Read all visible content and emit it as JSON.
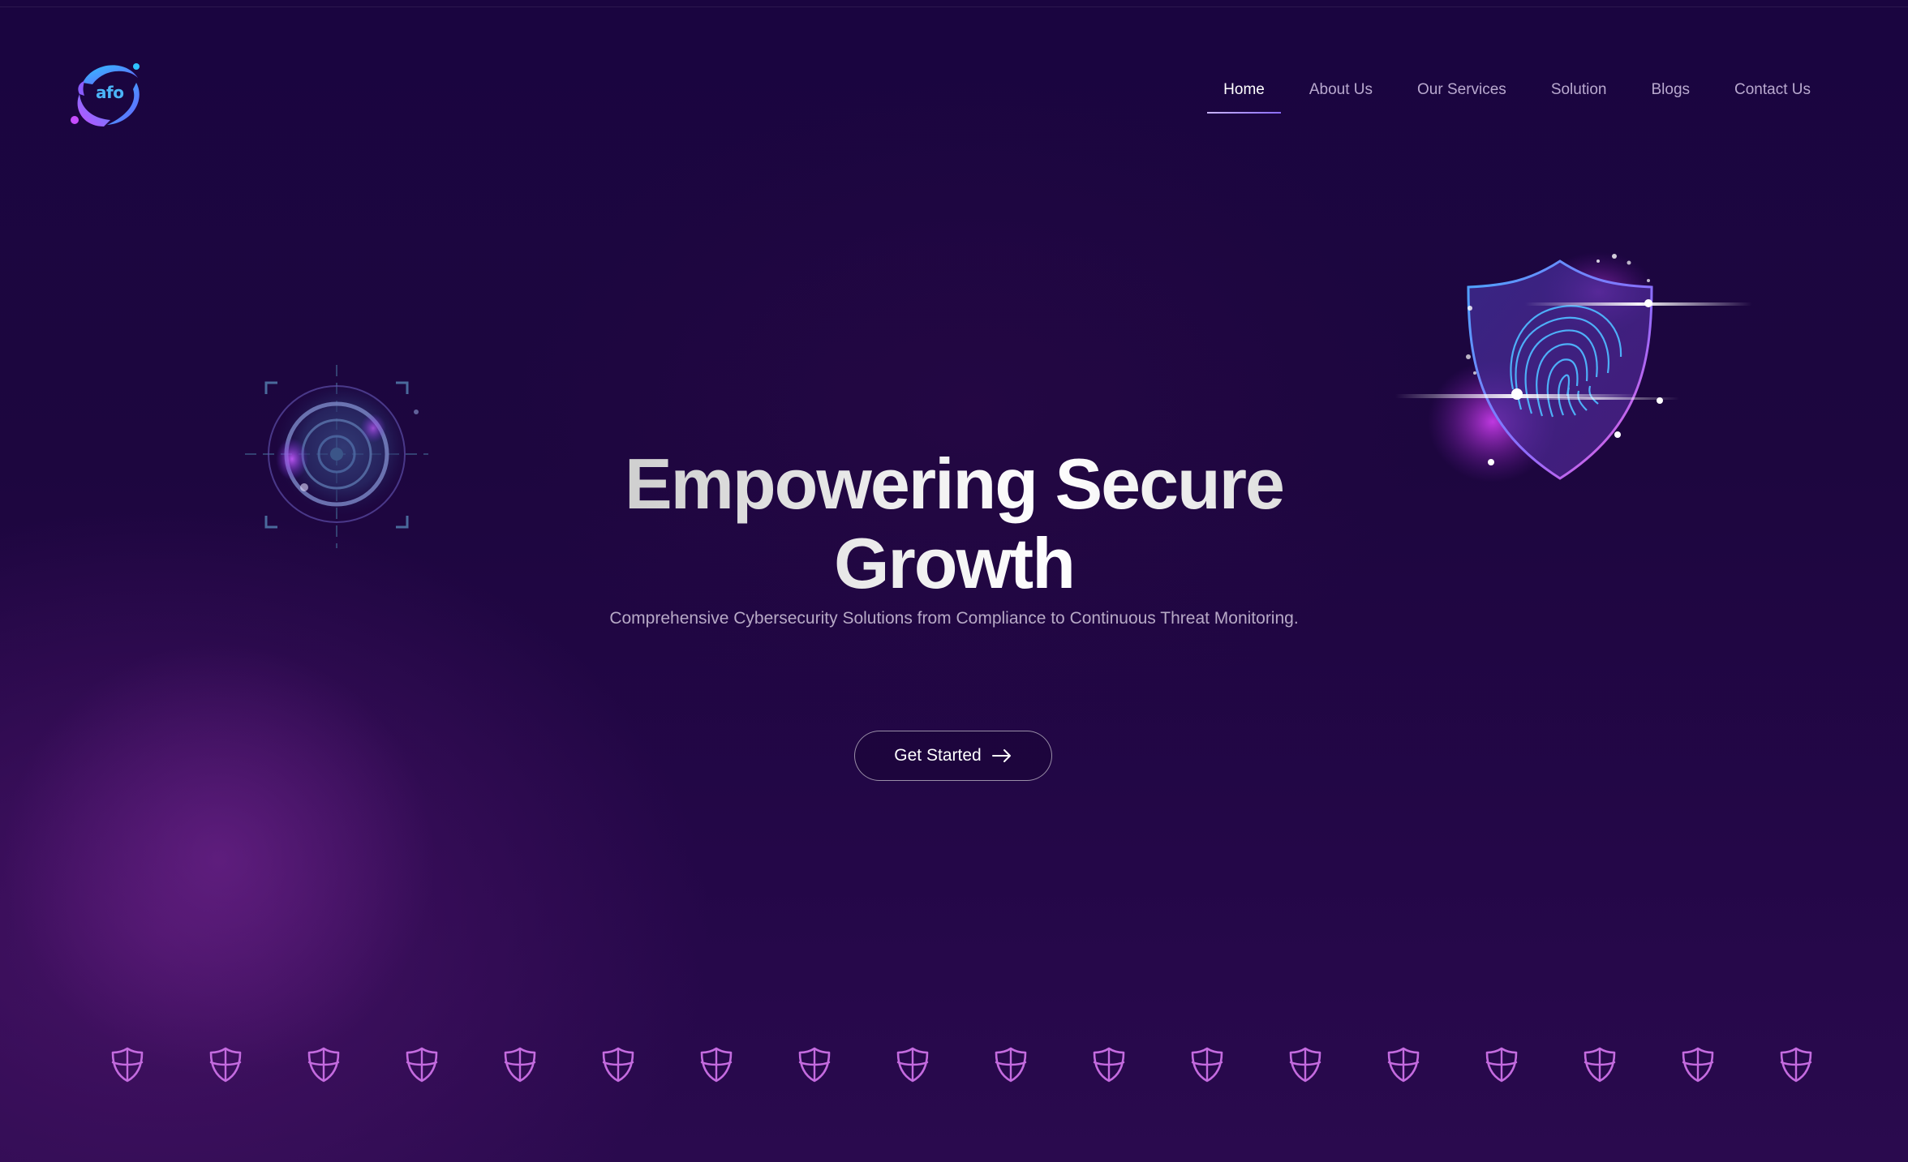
{
  "brand": {
    "logo_text": "afo",
    "colors": {
      "accent_blue": "#3aa8f0",
      "accent_purple": "#a24ad8",
      "shield_pink": "#c46bdf"
    }
  },
  "nav": {
    "items": [
      {
        "label": "Home",
        "active": true
      },
      {
        "label": "About Us",
        "active": false
      },
      {
        "label": "Our Services",
        "active": false
      },
      {
        "label": "Solution",
        "active": false
      },
      {
        "label": "Blogs",
        "active": false
      },
      {
        "label": "Contact Us",
        "active": false
      }
    ]
  },
  "hero": {
    "title_line1": "Empowering Secure",
    "title_line2": "Growth",
    "subtitle": "Comprehensive Cybersecurity Solutions from Compliance to Continuous Threat Monitoring.",
    "cta_label": "Get Started",
    "cta_icon": "arrow-right-icon"
  },
  "decor": {
    "left_icon": "target-scan-icon",
    "right_icon": "fingerprint-shield-icon",
    "row_icon": "shield-icon",
    "row_count": 18
  }
}
